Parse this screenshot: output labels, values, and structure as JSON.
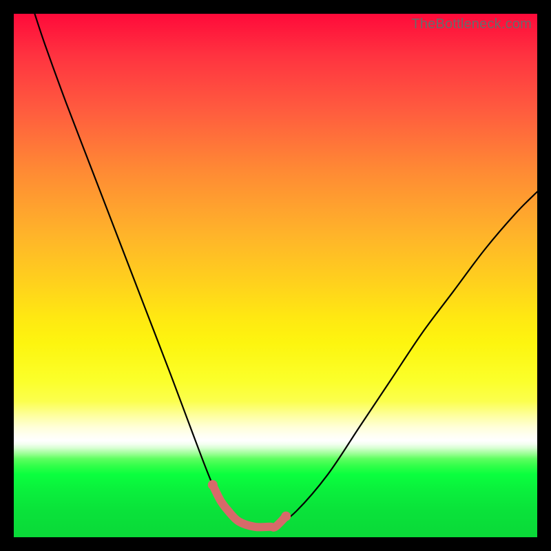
{
  "watermark": {
    "text": "TheBottleneck.com"
  },
  "chart_data": {
    "type": "line",
    "title": "",
    "xlabel": "",
    "ylabel": "",
    "xlim": [
      0,
      100
    ],
    "ylim": [
      0,
      100
    ],
    "grid": false,
    "legend": false,
    "series": [
      {
        "name": "bottleneck-curve",
        "x": [
          4,
          6,
          10,
          15,
          20,
          25,
          30,
          33,
          36,
          38,
          39.5,
          41,
          43,
          46,
          49,
          50,
          54,
          60,
          66,
          72,
          78,
          84,
          90,
          96,
          100
        ],
        "values": [
          100,
          94,
          83,
          70,
          57,
          44,
          31,
          23,
          15,
          10,
          7,
          5,
          3,
          2,
          2,
          2,
          5,
          12,
          21,
          30,
          39,
          47,
          55,
          62,
          66
        ]
      },
      {
        "name": "highlight-segment",
        "x": [
          38,
          39.5,
          41,
          43,
          46,
          49,
          50,
          52
        ],
        "values": [
          10,
          7,
          5,
          3,
          2,
          2,
          2,
          4
        ]
      }
    ],
    "highlight_color": "#d76a6a",
    "curve_color": "#000000"
  }
}
